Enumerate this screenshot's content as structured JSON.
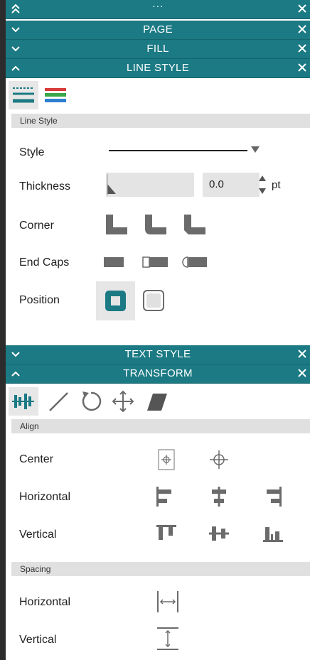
{
  "headers": {
    "top": {
      "title": "···"
    },
    "page": {
      "title": "PAGE"
    },
    "fill": {
      "title": "FILL"
    },
    "line_style": {
      "title": "LINE STYLE"
    },
    "text_style": {
      "title": "TEXT STYLE"
    },
    "transform": {
      "title": "TRANSFORM"
    }
  },
  "line_style": {
    "section_label": "Line Style",
    "style_label": "Style",
    "thickness_label": "Thickness",
    "thickness_value": "0.0",
    "thickness_unit": "pt",
    "corner_label": "Corner",
    "end_caps_label": "End Caps",
    "position_label": "Position"
  },
  "transform": {
    "align_section_label": "Align",
    "center_label": "Center",
    "horizontal_label": "Horizontal",
    "vertical_label": "Vertical",
    "spacing_section_label": "Spacing",
    "spacing_horizontal_label": "Horizontal",
    "spacing_vertical_label": "Vertical"
  },
  "colors": {
    "header_bg": "#1b7a84",
    "accent": "#1b7a84",
    "icon_gray": "#6b6b6b"
  }
}
